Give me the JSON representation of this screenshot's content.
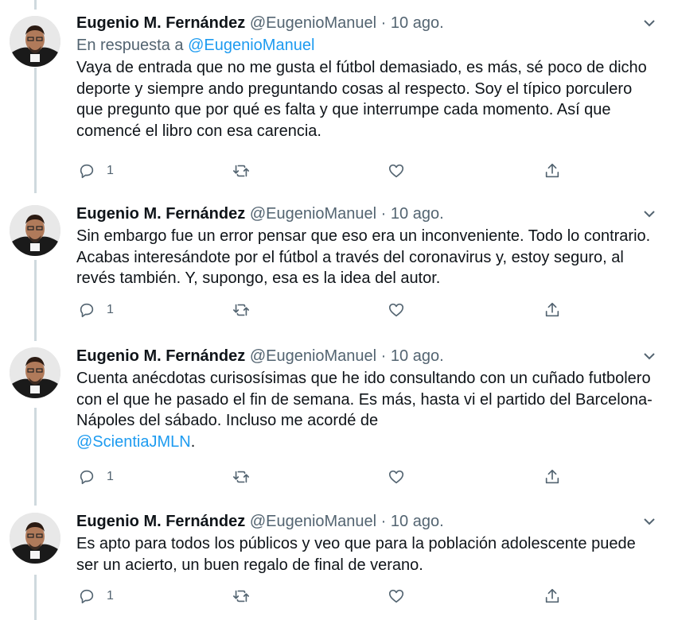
{
  "tweets": [
    {
      "name": "Eugenio M. Fernández",
      "handle": "@EugenioManuel",
      "separator": "·",
      "date": "10 ago.",
      "reply_prefix": "En respuesta a",
      "reply_mention": "@EugenioManuel",
      "text": "Vaya de entrada que no me gusta el fútbol demasiado, es más, sé poco de dicho deporte y siempre ando preguntando cosas al respecto. Soy el típico porculero que pregunto que por qué es falta y que interrumpe cada momento. Así que comencé el libro con esa carencia.",
      "reply_count": "1"
    },
    {
      "name": "Eugenio M. Fernández",
      "handle": "@EugenioManuel",
      "separator": "·",
      "date": "10 ago.",
      "text": "Sin embargo fue un error pensar que eso era un inconveniente. Todo lo contrario. Acabas interesándote por el fútbol a través del coronavirus y, estoy seguro, al revés también. Y, supongo, esa es la idea del autor.",
      "reply_count": "1"
    },
    {
      "name": "Eugenio M. Fernández",
      "handle": "@EugenioManuel",
      "separator": "·",
      "date": "10 ago.",
      "text": "Cuenta anécdotas curisosísimas que he ido consultando con un cuñado futbolero con el que he pasado el fin de semana. Es más, hasta vi el partido del Barcelona-Nápoles del sábado. Incluso me acordé de",
      "text_mention": "@ScientiaJMLN",
      "text_suffix": ".",
      "reply_count": "1"
    },
    {
      "name": "Eugenio M. Fernández",
      "handle": "@EugenioManuel",
      "separator": "·",
      "date": "10 ago.",
      "text": "Es apto para todos los públicos y veo que para la población adolescente puede ser un acierto, un buen regalo de final de verano.",
      "reply_count": "1"
    }
  ],
  "colors": {
    "text": "#0f1419",
    "secondary": "#536471",
    "link": "#1d9bf0",
    "thread_line": "#cfd9de"
  },
  "icons": [
    "reply-icon",
    "retweet-icon",
    "like-icon",
    "share-icon",
    "more-caret-icon"
  ]
}
